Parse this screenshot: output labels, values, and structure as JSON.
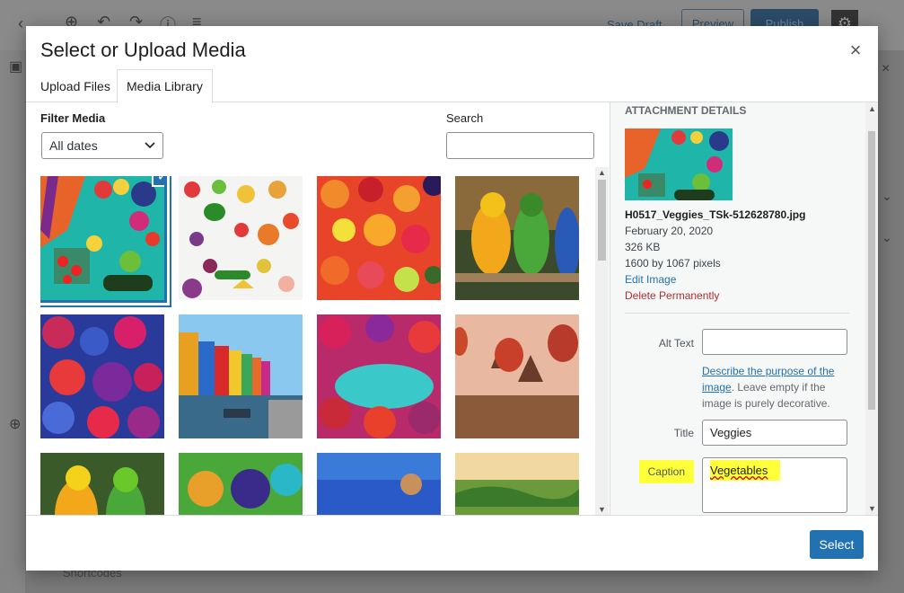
{
  "background": {
    "save_draft": "Save Draft",
    "preview": "Preview",
    "publish": "Publish",
    "shortcodes": "Shortcodes"
  },
  "modal": {
    "title": "Select or Upload Media",
    "close_icon": "close-icon"
  },
  "tabs": [
    {
      "label": "Upload Files",
      "active": false
    },
    {
      "label": "Media Library",
      "active": true
    }
  ],
  "filter": {
    "label": "Filter Media",
    "selected": "All dates"
  },
  "search": {
    "label": "Search",
    "value": ""
  },
  "attachment_details": {
    "heading": "ATTACHMENT DETAILS",
    "filename": "H0517_Veggies_TSk-512628780.jpg",
    "date": "February 20, 2020",
    "size": "326 KB",
    "dimensions": "1600 by 1067 pixels",
    "edit_link": "Edit Image",
    "delete_link": "Delete Permanently",
    "alt_label": "Alt Text",
    "alt_value": "",
    "alt_help_link": "Describe the purpose of the image",
    "alt_help_text": ". Leave empty if the image is purely decorative.",
    "title_label": "Title",
    "title_value": "Veggies",
    "caption_label": "Caption",
    "caption_value": "Vegetables"
  },
  "footer": {
    "select_button": "Select"
  },
  "colors": {
    "accent": "#2271b1",
    "danger": "#b32d2e",
    "highlight": "#ffff3a"
  }
}
